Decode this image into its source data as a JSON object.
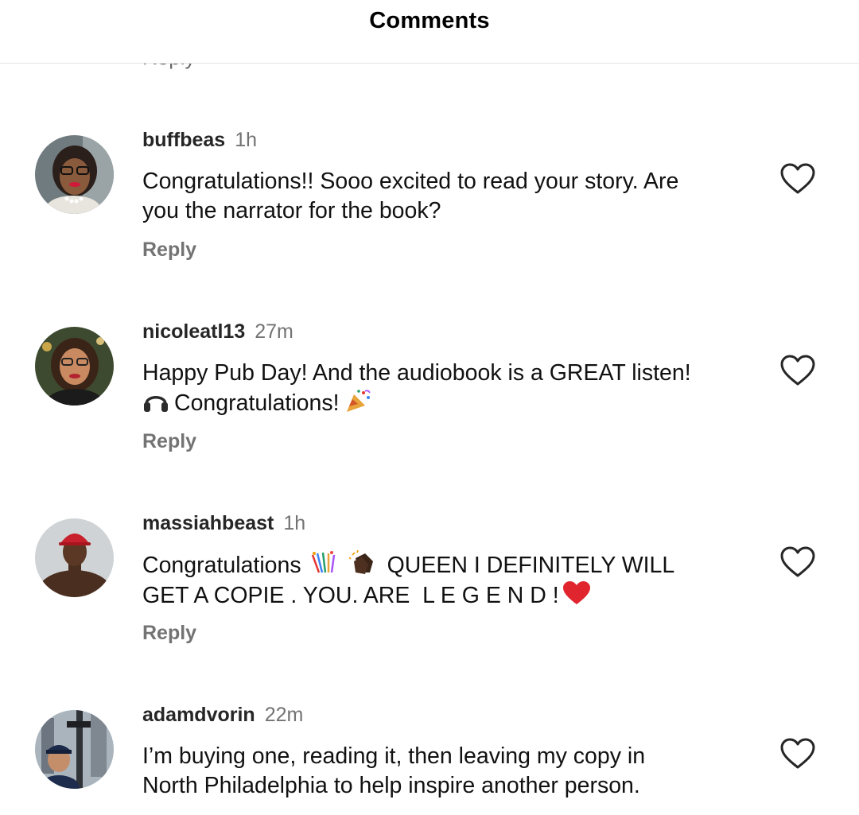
{
  "header": {
    "title": "Comments"
  },
  "cut_reply_label": "Reply",
  "comments": [
    {
      "username": "buffbeas",
      "time": "1h",
      "text_line1": "Congratulations!! Sooo excited to read your story. Are",
      "text_line2": "you the narrator for the book?",
      "reply": "Reply"
    },
    {
      "username": "nicoleatl13",
      "time": "27m",
      "text_line1": "Happy Pub Day! And the audiobook is a GREAT listen!",
      "text_line2": "Congratulations!",
      "reply": "Reply"
    },
    {
      "username": "massiahbeast",
      "time": "1h",
      "text_part1": "Congratulations",
      "text_part2": "QUEEN I DEFINITELY WILL",
      "text_line2": "GET A COPIE . YOU. ARE  L E G E N D !",
      "reply": "Reply"
    },
    {
      "username": "adamdvorin",
      "time": "22m",
      "text_line1": "I’m buying one, reading it, then leaving my copy in",
      "text_line2": "North Philadelphia to help inspire another person."
    }
  ],
  "icons": {
    "like": "heart-outline-icon",
    "headphones": "headphones-emoji",
    "party": "party-popper-emoji",
    "confetti": "confetti-ball-emoji",
    "clap": "clapping-hands-emoji",
    "heart_red": "red-heart-emoji"
  },
  "colors": {
    "username": "#262626",
    "meta": "#737373",
    "text": "#111111",
    "divider": "#e6e6e6",
    "heart_emoji": "#e0252f"
  }
}
